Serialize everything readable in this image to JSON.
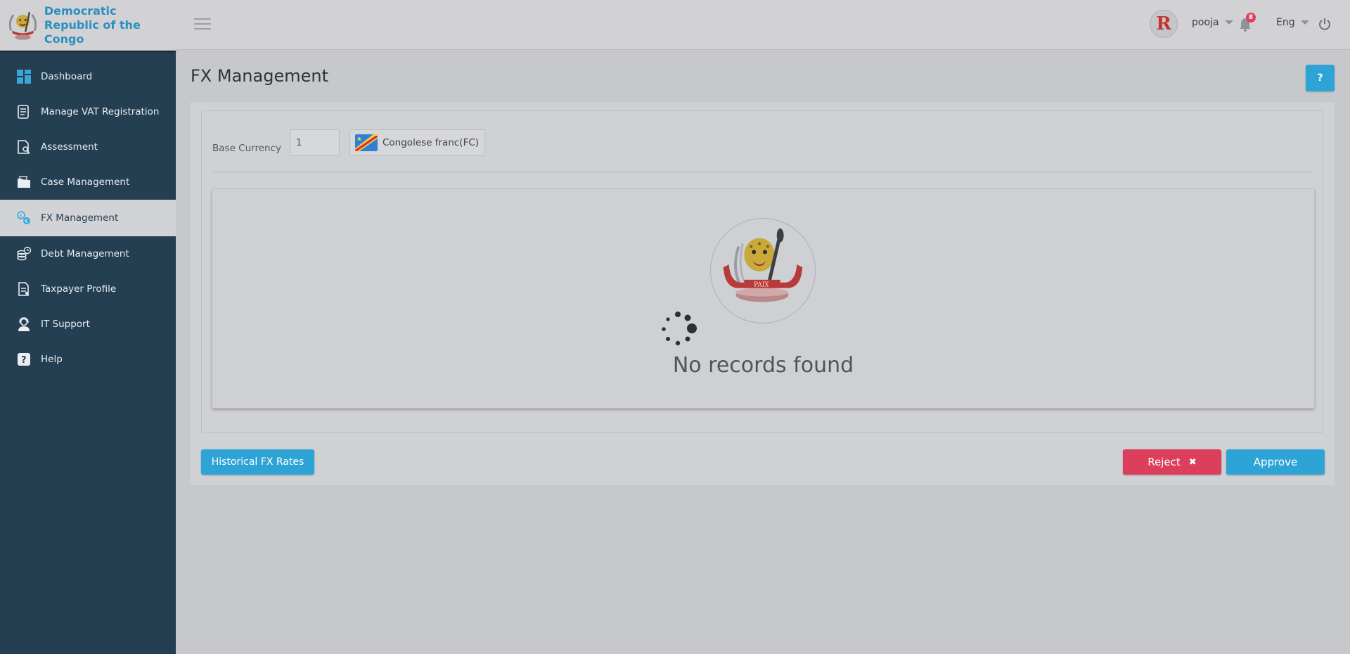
{
  "brand": {
    "line1": "Democratic",
    "line2": "Republic of the Congo",
    "logo_icon": "drc-coat-of-arms-icon"
  },
  "sidebar": {
    "items": [
      {
        "label": "Dashboard",
        "icon": "dashboard-icon"
      },
      {
        "label": "Manage VAT Registration",
        "icon": "document-list-icon"
      },
      {
        "label": "Assessment",
        "icon": "document-search-icon"
      },
      {
        "label": "Case Management",
        "icon": "folder-icon"
      },
      {
        "label": "FX Management",
        "icon": "currency-exchange-icon",
        "active": true
      },
      {
        "label": "Debt Management",
        "icon": "coins-clock-icon"
      },
      {
        "label": "Taxpayer Profile",
        "icon": "profile-document-icon"
      },
      {
        "label": "IT Support",
        "icon": "support-agent-icon"
      },
      {
        "label": "Help",
        "icon": "question-icon"
      }
    ]
  },
  "topbar": {
    "avatar_initial": "R",
    "username": "pooja",
    "notification_count": "8",
    "language": "Eng"
  },
  "page": {
    "title": "FX Management",
    "help_label": "?"
  },
  "filter": {
    "base_currency_label": "Base Currency",
    "amount_value": "1",
    "currency_name": "Congolese franc(FC)"
  },
  "records": {
    "empty_message": "No records found"
  },
  "actions": {
    "historical_label": "Historical FX Rates",
    "reject_label": "Reject",
    "reject_icon": "✖",
    "approve_label": "Approve"
  },
  "colors": {
    "sidebar_bg": "#243e52",
    "accent": "#2ea4d6",
    "danger": "#dc3f5b"
  }
}
